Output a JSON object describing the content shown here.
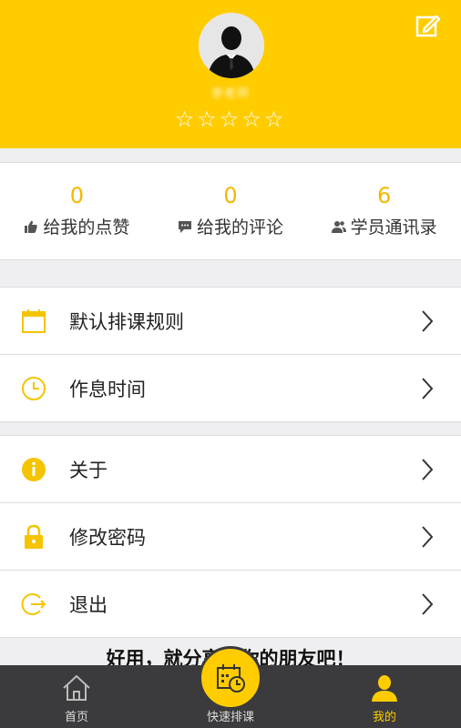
{
  "header": {
    "username": "李老师",
    "stars": "☆☆☆☆☆",
    "edit_icon": "edit-icon",
    "avatar_icon": "avatar-silhouette"
  },
  "stats": [
    {
      "value": "0",
      "label": "给我的点赞",
      "icon": "thumbs-up-icon"
    },
    {
      "value": "0",
      "label": "给我的评论",
      "icon": "comment-icon"
    },
    {
      "value": "6",
      "label": "学员通讯录",
      "icon": "users-icon"
    }
  ],
  "menu_group_1": [
    {
      "label": "默认排课规则",
      "icon": "calendar-icon"
    },
    {
      "label": "作息时间",
      "icon": "clock-icon"
    }
  ],
  "menu_group_2": [
    {
      "label": "关于",
      "icon": "info-icon"
    },
    {
      "label": "修改密码",
      "icon": "lock-icon"
    },
    {
      "label": "退出",
      "icon": "logout-icon"
    }
  ],
  "share_text": "好用，就分享给你的朋友吧！",
  "tabbar": {
    "home": "首页",
    "quick_schedule": "快速排课",
    "mine": "我的"
  },
  "colors": {
    "accent": "#ffcc00",
    "stat_value": "#f5b800",
    "tabbar_bg": "#3b3b3d",
    "tab_active": "#ffcc00"
  }
}
